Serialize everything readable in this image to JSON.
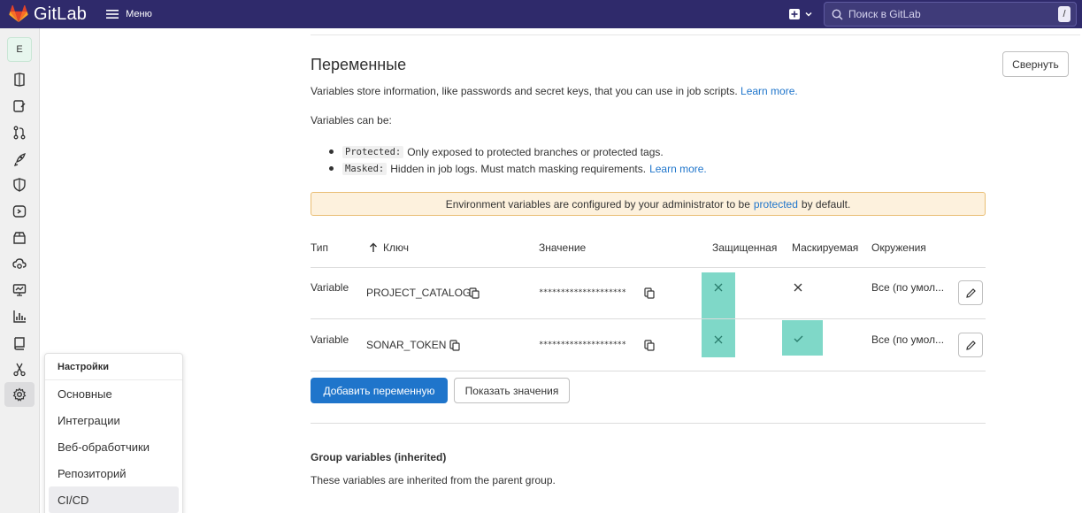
{
  "header": {
    "logo_text": "GitLab",
    "menu_label": "Меню",
    "search_placeholder": "Поиск в GitLab",
    "search_shortcut": "/"
  },
  "sidebar": {
    "project_initial": "E",
    "icons": [
      "project-overview-icon",
      "issues-icon",
      "merge-requests-icon",
      "deployments-icon",
      "security-icon",
      "ci-cd-icon",
      "packages-icon",
      "infrastructure-icon",
      "monitor-icon",
      "analytics-icon",
      "wiki-icon",
      "snippets-icon",
      "settings-icon"
    ]
  },
  "flyout": {
    "title": "Настройки",
    "items": [
      "Основные",
      "Интеграции",
      "Веб-обработчики",
      "Репозиторий",
      "CI/CD"
    ],
    "active_item": "CI/CD"
  },
  "section": {
    "title": "Переменные",
    "collapse_label": "Свернуть",
    "intro": "Variables store information, like passwords and secret keys, that you can use in job scripts.",
    "learn_more": "Learn more.",
    "can_be": "Variables can be:",
    "bullets": [
      {
        "code": "Protected:",
        "text": "Only exposed to protected branches or protected tags.",
        "link": ""
      },
      {
        "code": "Masked:",
        "text": "Hidden in job logs. Must match masking requirements.",
        "link": "Learn more."
      }
    ],
    "alert_before": "Environment variables are configured by your administrator to be",
    "alert_link": "protected",
    "alert_after": "by default."
  },
  "table": {
    "headers": {
      "type": "Тип",
      "key": "Ключ",
      "value": "Значение",
      "protected": "Защищенная",
      "masked": "Маскируемая",
      "environments": "Окружения"
    },
    "rows": [
      {
        "type": "Variable",
        "key": "PROJECT_CATALOG",
        "value": "********************",
        "protected": false,
        "masked": false,
        "environments": "Все (по умол..."
      },
      {
        "type": "Variable",
        "key": "SONAR_TOKEN",
        "value": "********************",
        "protected": false,
        "masked": true,
        "environments": "Все (по умол..."
      }
    ]
  },
  "actions": {
    "add_variable": "Добавить переменную",
    "reveal_values": "Показать значения"
  },
  "group_variables": {
    "title": "Group variables (inherited)",
    "text": "These variables are inherited from the parent group."
  },
  "colors": {
    "topbar": "#2f2a6b",
    "primary": "#1f75cb",
    "highlight": "#7fd8c8",
    "alert_bg": "#fdf1dd",
    "alert_border": "#e9be74"
  }
}
